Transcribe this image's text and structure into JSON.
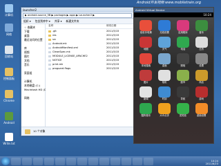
{
  "watermark": "Android开发视频 www.mobiletrain.org",
  "explorer": {
    "title": "launcher2",
    "address": "▶ android-source_5B ▶ packages ▶ apps ▶ Launcher2 ▶",
    "toolbar": [
      "组织 ▾",
      "包含到库中 ▾",
      "共享 ▾",
      "新建文件夹"
    ],
    "sidebar": [
      "☆ 收藏夹",
      "下载",
      "桌面",
      "最近访问的位置",
      "",
      "库",
      "视频",
      "图片",
      "文档",
      "音乐",
      "",
      "家庭组",
      "",
      "计算机",
      "本地磁盘 (C:)",
      "Macintosh HD (D:)",
      "",
      "网络"
    ],
    "col_name": "名称",
    "col_date": "修改日期",
    "rows": [
      {
        "name": ".git",
        "date": "2011/5/15",
        "type": "folder"
      },
      {
        "name": "res",
        "date": "2011/5/15",
        "type": "folder"
      },
      {
        "name": "src",
        "date": "2011/5/15",
        "type": "folder"
      },
      {
        "name": "Android.mk",
        "date": "2011/5/15",
        "type": "file"
      },
      {
        "name": "AndroidManifest.xml",
        "date": "2011/5/15",
        "type": "file"
      },
      {
        "name": "CleanSpec.mk",
        "date": "2011/5/15",
        "type": "file"
      },
      {
        "name": "MODULE_LICENSE_APACHE2",
        "date": "2011/5/15",
        "type": "file"
      },
      {
        "name": "NOTICE",
        "date": "2011/5/15",
        "type": "file"
      },
      {
        "name": "print.mk",
        "date": "2011/5/15",
        "type": "file"
      },
      {
        "name": "proguard.flags",
        "date": "2011/5/15",
        "type": "file"
      }
    ],
    "status": "10 个对象"
  },
  "emulator": {
    "title": "Android Virtual Device",
    "time": "10:24",
    "apps": [
      {
        "label": "色彩手电筒",
        "color": "#e94f3b"
      },
      {
        "label": "无线设置",
        "color": "#2e7bd6"
      },
      {
        "label": "应用程序",
        "color": "#d83a7c"
      },
      {
        "label": "音乐",
        "color": "#3c8d3f"
      },
      {
        "label": "地图",
        "color": "#c93535"
      },
      {
        "label": "天气",
        "color": "#5ea3d9"
      },
      {
        "label": "电话",
        "color": "#2fa84f"
      },
      {
        "label": "日历",
        "color": "#dcdcdc"
      },
      {
        "label": "本地搜索",
        "color": "#e2463b"
      },
      {
        "label": "桌面",
        "color": "#7aa7cf"
      },
      {
        "label": "照相",
        "color": "#444444"
      },
      {
        "label": "设置",
        "color": "#888888"
      },
      {
        "label": "图片",
        "color": "#bf3b3b"
      },
      {
        "label": "相机",
        "color": "#e0e0e0"
      },
      {
        "label": "股市",
        "color": "#8ab04b"
      },
      {
        "label": "商店",
        "color": "#cc9a2b"
      },
      {
        "label": "新闻",
        "color": "#e3e3e3"
      },
      {
        "label": "时钟",
        "color": "#3f8bd2"
      },
      {
        "label": "导航",
        "color": "#3a3a3a"
      },
      {
        "label": "游戏",
        "color": "#b72e2e"
      },
      {
        "label": "酷狗音乐",
        "color": "#2ea84f"
      },
      {
        "label": "大众点评",
        "color": "#f0a11e"
      },
      {
        "label": "发短信",
        "color": "#35b24a"
      },
      {
        "label": "桌面设置",
        "color": "#f28c28"
      }
    ]
  },
  "desktop_icons": [
    {
      "label": "计算机"
    },
    {
      "label": "网络"
    },
    {
      "label": "回收站"
    },
    {
      "label": "控制面板"
    },
    {
      "label": "Chrome"
    },
    {
      "label": "Android"
    },
    {
      "label": "Write.txt"
    }
  ],
  "taskbar": {
    "time": "10:24",
    "date": "2011/6/23"
  }
}
